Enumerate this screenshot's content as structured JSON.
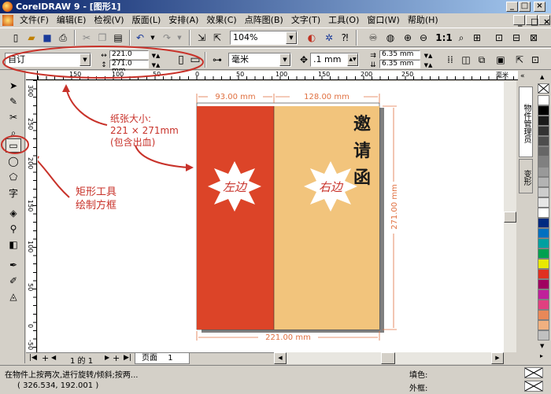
{
  "window": {
    "title": "CorelDRAW 9 - [图形1]"
  },
  "menu": [
    "文件(F)",
    "编辑(E)",
    "检视(V)",
    "版面(L)",
    "安排(A)",
    "效果(C)",
    "点阵图(B)",
    "文字(T)",
    "工具(O)",
    "窗口(W)",
    "帮助(H)"
  ],
  "toolbar": {
    "zoom": "104%"
  },
  "propbar": {
    "paper_type": "自订",
    "width": "221.0 mm",
    "height": "271.0 mm",
    "unit": "毫米",
    "nudge": ".1 mm",
    "dup_x": "6.35 mm",
    "dup_y": "6.35 mm"
  },
  "ruler": {
    "h_labels": [
      "150",
      "100",
      "50",
      "0",
      "50",
      "100",
      "150",
      "200",
      "250",
      "毫米"
    ],
    "v_labels": [
      "300",
      "250",
      "200",
      "150",
      "100",
      "50",
      "0",
      "-50"
    ]
  },
  "design": {
    "dim_left": "93.00 mm",
    "dim_right": "128.00 mm",
    "dim_bottom": "221.00 mm",
    "dim_side": "271.00 mm",
    "left_star": "左边",
    "right_star": "右边",
    "invite_title": [
      "邀",
      "请",
      "函"
    ],
    "colors": {
      "left_panel": "#dc4428",
      "right_panel": "#f2c47c",
      "dimension": "#e07040",
      "annotation": "#c8322a"
    }
  },
  "annotations": {
    "paper_size": [
      "纸张大小:",
      "221 × 271mm",
      "(包含出血)"
    ],
    "rect_tool": [
      "矩形工具",
      "绘制方框"
    ]
  },
  "pagetabs": {
    "current": "1 的 1",
    "tab_label": "页面",
    "tab_num": "1"
  },
  "docker_tabs": [
    "物件管理员",
    "变形"
  ],
  "status": {
    "hint": "在物件上按两次,进行旋转/倾斜;按两...",
    "coords": "( 326.534, 192.001 )",
    "fill_label": "填色:",
    "outline_label": "外框:"
  },
  "palette_colors": [
    "#ffffff",
    "#000000",
    "#1a1a1a",
    "#333333",
    "#4d4d4d",
    "#666666",
    "#808080",
    "#999999",
    "#b3b3b3",
    "#cccccc",
    "#e6e6e6",
    "#ffffff",
    "#002a80",
    "#0070c0",
    "#00a0a0",
    "#00a050",
    "#e8e800",
    "#e03020",
    "#a00060",
    "#c0209a",
    "#e04080",
    "#e88858",
    "#f0b080",
    "#c0c0c0"
  ]
}
